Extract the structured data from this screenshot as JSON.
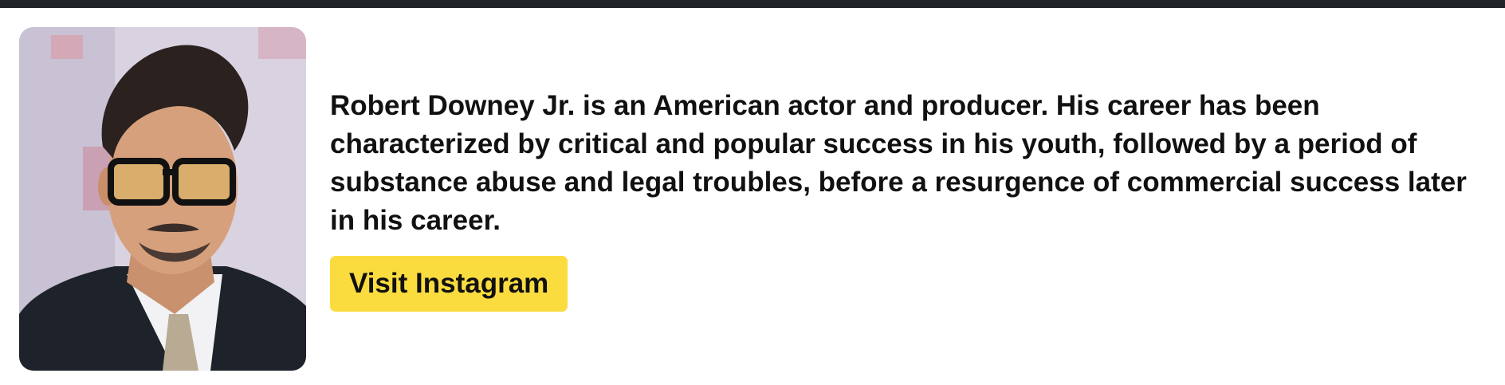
{
  "profile": {
    "photo_icon": "portrait-photo",
    "bio": "Robert Downey Jr. is an American actor and producer. His career has been characterized by critical and popular success in his youth, followed by a period of substance abuse and legal troubles, before a resurgence of commercial success later in his career.",
    "button_label": "Visit Instagram",
    "button_color": "#fbdc3f",
    "topbar_color": "#212529"
  }
}
